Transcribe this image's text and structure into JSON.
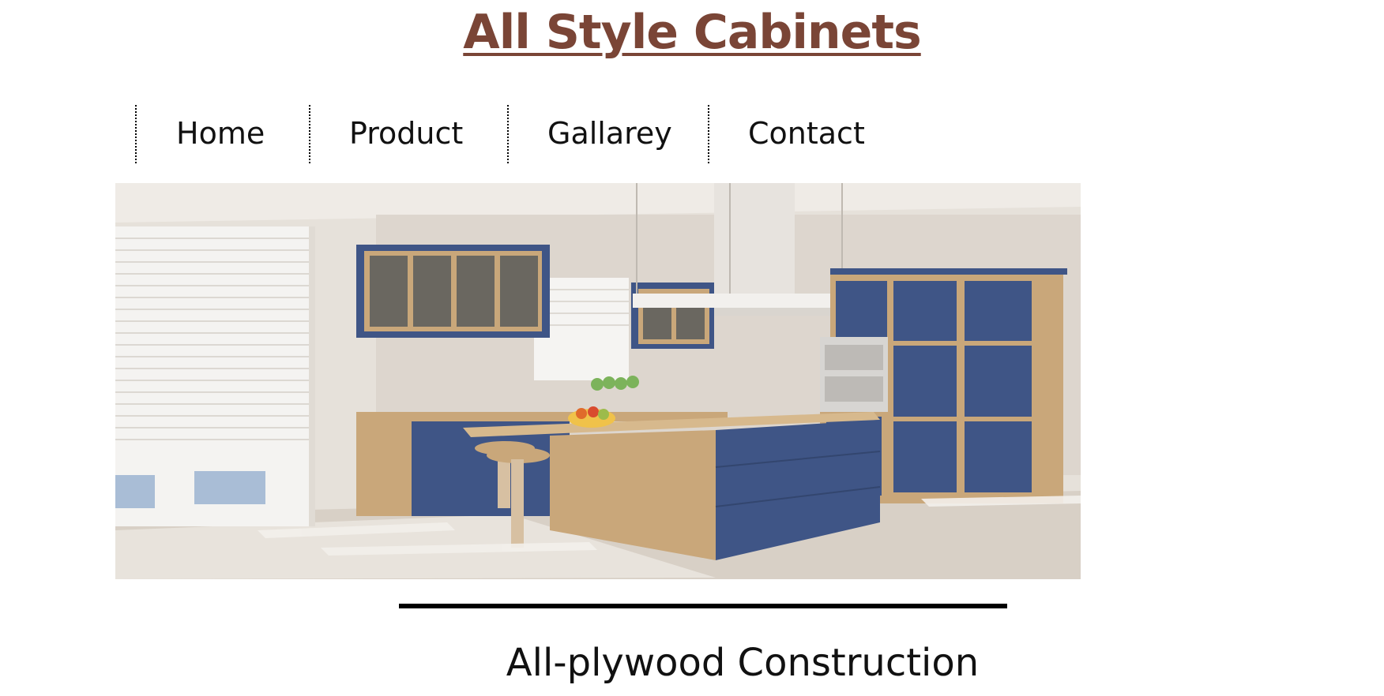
{
  "header": {
    "site_title": "All Style Cabinets"
  },
  "nav": {
    "items": [
      {
        "label": "Home"
      },
      {
        "label": "Product"
      },
      {
        "label": "Gallarey"
      },
      {
        "label": "Contact"
      }
    ]
  },
  "hero": {
    "image_description_icon": "kitchen-photo"
  },
  "main": {
    "section_heading": "All-plywood Construction"
  },
  "colors": {
    "title": "#7a4536",
    "cabinet_blue": "#3f5586",
    "wood": "#c9a77a"
  }
}
